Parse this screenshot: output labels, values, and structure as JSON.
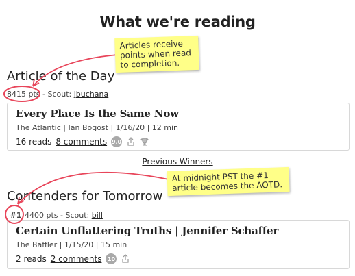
{
  "page": {
    "title": "What we're reading"
  },
  "article_of_the_day": {
    "heading": "Article of the Day",
    "points": "8415 pts",
    "scout_prefix": " - Scout: ",
    "scout": "jbuchana",
    "article": {
      "title": "Every Place Is the Same Now",
      "source": "The Atlantic | Ian Bogost | 1/16/20 | 12 min",
      "reads": "16 reads",
      "comments": "8 comments",
      "score": "9.0",
      "icons": [
        "score-badge",
        "share-icon",
        "trophy-icon"
      ]
    }
  },
  "previous_winners": {
    "label": "Previous Winners"
  },
  "contenders": {
    "heading": "Contenders for Tomorrow",
    "rank": "#1",
    "points": "4400 pts",
    "scout_prefix": " - Scout: ",
    "scout": "bill",
    "article": {
      "title": "Certain Unflattering Truths | Jennifer Schaffer",
      "source": "The Baffler | 1/15/20 | 15 min",
      "reads": "2 reads",
      "comments": "2 comments",
      "score": "10",
      "icons": [
        "score-badge",
        "share-icon"
      ]
    }
  },
  "annotations": {
    "note1": "Articles receive points when read to completion.",
    "note2": "At midnight PST the #1 article becomes the AOTD.",
    "note_color": "#ffff88",
    "marker_color": "#e8455a"
  }
}
